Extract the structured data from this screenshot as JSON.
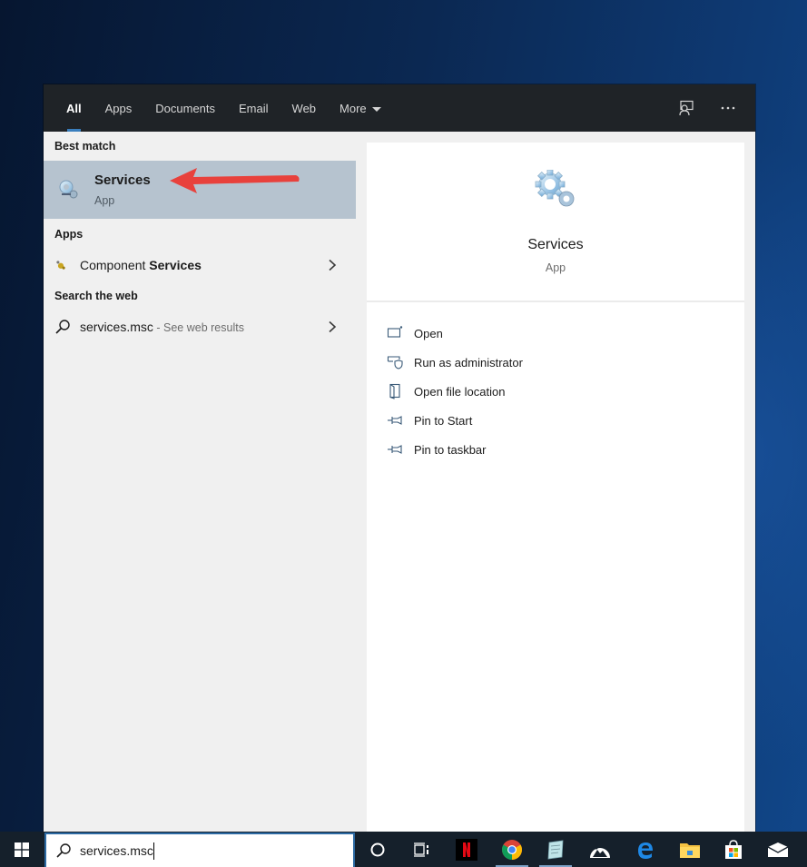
{
  "search_panel": {
    "tabs": [
      {
        "label": "All",
        "active": true
      },
      {
        "label": "Apps",
        "active": false
      },
      {
        "label": "Documents",
        "active": false
      },
      {
        "label": "Email",
        "active": false
      },
      {
        "label": "Web",
        "active": false
      },
      {
        "label": "More",
        "active": false,
        "has_dropdown": true
      }
    ],
    "topbar_icons": [
      "feedback-icon",
      "more-options-icon"
    ],
    "best_match": {
      "header": "Best match",
      "title": "Services",
      "subtitle": "App",
      "icon": "services-gears-icon",
      "annotation": "red-arrow-pointing-left"
    },
    "apps": {
      "header": "Apps",
      "items": [
        {
          "prefix": "Component ",
          "bold": "Services",
          "icon": "component-services-icon"
        }
      ]
    },
    "web": {
      "header": "Search the web",
      "items": [
        {
          "query": "services.msc",
          "hint": " - See web results",
          "icon": "search-icon"
        }
      ]
    },
    "detail": {
      "title": "Services",
      "subtitle": "App",
      "icon": "services-gears-icon",
      "actions": [
        {
          "label": "Open",
          "icon": "open-icon"
        },
        {
          "label": "Run as administrator",
          "icon": "run-as-admin-icon"
        },
        {
          "label": "Open file location",
          "icon": "file-location-icon"
        },
        {
          "label": "Pin to Start",
          "icon": "pin-icon"
        },
        {
          "label": "Pin to taskbar",
          "icon": "pin-icon"
        }
      ]
    }
  },
  "taskbar": {
    "search_value": "services.msc",
    "items": [
      {
        "name": "cortana"
      },
      {
        "name": "task-view"
      },
      {
        "name": "netflix"
      },
      {
        "name": "chrome"
      },
      {
        "name": "notepad-app"
      },
      {
        "name": "photos-app"
      },
      {
        "name": "edge"
      },
      {
        "name": "file-explorer"
      },
      {
        "name": "microsoft-store"
      },
      {
        "name": "mail"
      }
    ]
  },
  "colors": {
    "accent": "#3a7ebd",
    "best_match_bg": "#b6c3cf",
    "topbar_bg": "#1f2327",
    "taskbar_bg": "#15202b",
    "arrow": "#e8413c"
  }
}
